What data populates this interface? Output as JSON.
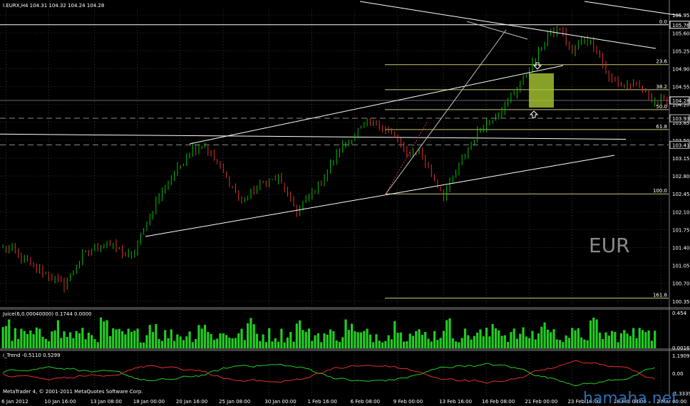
{
  "header": {
    "main": "I.EURX,H4  104.31 104.32 104.24 104.28",
    "juice": "Juice(6,0.00040000) 0.1744 0.0000",
    "trend": "i_Trend -0.5110 0.5299",
    "copyright": "MetaTrader 4, © 2001-2011 MetaQuotes Software Corp."
  },
  "symbol_label": "EUR",
  "watermark": "hamaha.net",
  "colors": {
    "up": "#00c000",
    "down": "#e03030",
    "juice": "#22cc22",
    "fib": "#c8c878",
    "zone": "#a8c832"
  },
  "chart_data": [
    {
      "type": "candlestick",
      "panel": "main",
      "x_ticks": [
        "6 Jan 2012",
        "10 Jan 16:00",
        "13 Jan 08:00",
        "18 Jan 00:00",
        "20 Jan 16:00",
        "25 Jan 08:00",
        "30 Jan 00:00",
        "1 Feb 16:00",
        "6 Feb 08:00",
        "9 Feb 00:00",
        "13 Feb 16:00",
        "16 Feb 08:00",
        "21 Feb 00:00",
        "23 Feb 16:00",
        "28 Feb 08:00",
        "2 Mar 00:00"
      ],
      "y_ticks": [
        "105.95",
        "105.60",
        "105.25",
        "104.90",
        "104.55",
        "104.20",
        "103.85",
        "103.50",
        "103.15",
        "102.80",
        "102.45",
        "102.10",
        "101.75",
        "101.40",
        "101.05",
        "100.70",
        "100.35"
      ],
      "ylim": [
        100.25,
        106.05
      ],
      "price_tags": [
        {
          "text": "105.76",
          "value": 105.76,
          "color": "#ffffff"
        },
        {
          "text": "104.28",
          "value": 104.28,
          "color": "#ffffff"
        },
        {
          "text": "103.93",
          "value": 103.93,
          "color": "#c0c0c0"
        },
        {
          "text": "103.41",
          "value": 103.41,
          "color": "#c0c0c0"
        }
      ],
      "fib_levels": [
        {
          "label": "0.0",
          "value": 105.76
        },
        {
          "label": "23.6",
          "value": 104.98
        },
        {
          "label": "38.2",
          "value": 104.49
        },
        {
          "label": "50.0",
          "value": 104.1
        },
        {
          "label": "61.8",
          "value": 103.71
        },
        {
          "label": "100.0",
          "value": 102.45
        },
        {
          "label": "161.8",
          "value": 100.41
        }
      ],
      "anchors": [
        [
          2,
          101.4
        ],
        [
          8,
          101.1
        ],
        [
          14,
          100.9
        ],
        [
          20,
          100.65
        ],
        [
          26,
          101.25
        ],
        [
          34,
          101.5
        ],
        [
          42,
          101.2
        ],
        [
          50,
          102.3
        ],
        [
          56,
          102.85
        ],
        [
          62,
          103.35
        ],
        [
          66,
          103.4
        ],
        [
          72,
          102.85
        ],
        [
          78,
          102.3
        ],
        [
          84,
          102.65
        ],
        [
          90,
          102.75
        ],
        [
          96,
          102.1
        ],
        [
          104,
          102.7
        ],
        [
          110,
          103.3
        ],
        [
          116,
          103.7
        ],
        [
          122,
          103.85
        ],
        [
          128,
          103.55
        ],
        [
          132,
          103.2
        ],
        [
          136,
          103.3
        ],
        [
          140,
          102.8
        ],
        [
          144,
          102.45
        ],
        [
          150,
          103.1
        ],
        [
          156,
          103.75
        ],
        [
          162,
          104.05
        ],
        [
          168,
          104.5
        ],
        [
          174,
          105.1
        ],
        [
          178,
          105.55
        ],
        [
          182,
          105.7
        ],
        [
          186,
          105.2
        ],
        [
          190,
          105.5
        ],
        [
          194,
          105.3
        ],
        [
          198,
          104.7
        ],
        [
          202,
          104.6
        ],
        [
          208,
          104.55
        ],
        [
          212,
          104.3
        ],
        [
          216,
          104.25
        ]
      ],
      "juice_ticks": [
        "0.454",
        "0.0016"
      ],
      "trend_ticks": [
        "1.1909",
        "0.00",
        "-1.3339"
      ]
    }
  ]
}
